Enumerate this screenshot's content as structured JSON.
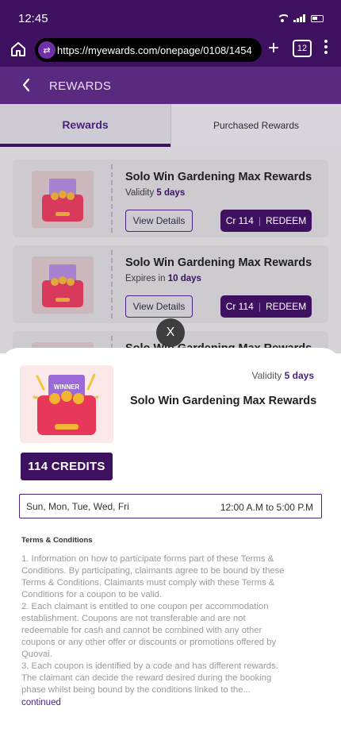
{
  "status_bar": {
    "time": "12:45"
  },
  "browser": {
    "url": "https://myewards.com/onepage/0108/1454",
    "tab_count": "12",
    "plus_label": "+"
  },
  "header": {
    "title": "REWARDS",
    "back_icon": "chevron-left-icon"
  },
  "tabs": [
    {
      "label": "Rewards",
      "active": true
    },
    {
      "label": "Purchased Rewards",
      "active": false
    }
  ],
  "rewards": [
    {
      "title": "Solo Win Gardening Max Rewards",
      "meta_prefix": "Validity",
      "meta_value": "5 days",
      "details_label": "View Details",
      "credits": "Cr 114",
      "separator": "|",
      "redeem_label": "REDEEM"
    },
    {
      "title": "Solo Win Gardening Max Rewards",
      "meta_prefix": "Expires in",
      "meta_value": "10 days",
      "details_label": "View Details",
      "credits": "Cr 114",
      "separator": "|",
      "redeem_label": "REDEEM"
    },
    {
      "title": "Solo Win Gardening Max Rewards"
    }
  ],
  "close_label": "X",
  "sheet": {
    "validity_prefix": "Validity",
    "validity_value": "5 days",
    "title": "Solo Win Gardening Max Rewards",
    "credits_label": "114 CREDITS",
    "schedule_days": "Sun, Mon, Tue, Wed, Fri",
    "schedule_time": "12:00 A.M to 5:00 P.M",
    "tnc_heading": "Terms & Conditions",
    "tnc_lines": [
      "1. Information on how to participate forms part of these Terms &",
      "Conditions. By participating, claimants agree to be bound by these",
      "Terms & Conditions. Claimants must comply with these Terms &",
      "Conditions for a coupon to be valid.",
      "2. Each claimant is entitled to one coupon per accommodation",
      "establishment. Coupons are not transferable and are not",
      "redeemable for cash and cannot be combined with any other",
      "coupons or any other offer or discounts or promotions offered by",
      "Quovai.",
      "3. Each coupon is identified by a code and has different rewards.",
      "The claimant can decide the reward desired during the booking",
      "phase whilst being bound by the conditions linked to the..."
    ],
    "continued_label": "continued"
  },
  "thumbnail": {
    "badge_text": "WINNER",
    "colors": {
      "envelope": "#e8385a",
      "ticket": "#9b6ad6",
      "coin": "#f2b632"
    }
  },
  "colors": {
    "primary": "#3d1160",
    "header": "#5a2a80",
    "accent_text": "#4a2280"
  }
}
